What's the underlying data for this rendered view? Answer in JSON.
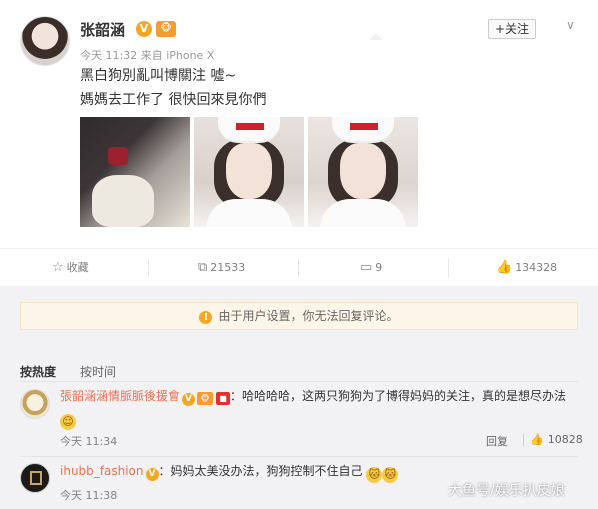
{
  "post": {
    "username": "张韶涵",
    "verified_badge": "V",
    "level_badge": "🐵",
    "meta": "今天 11:32 来自 iPhone X",
    "follow_label": "+关注",
    "line1": "黑白狗別亂叫博關注 噓~",
    "line2": "媽媽去工作了 很快回來見你們"
  },
  "actions": {
    "favorite": {
      "icon": "star-icon",
      "label": "收藏"
    },
    "repost": {
      "icon": "repost-icon",
      "count": "21533"
    },
    "comment": {
      "icon": "comment-icon",
      "count": "9"
    },
    "like": {
      "icon": "thumbs-up-icon",
      "count": "134328"
    }
  },
  "comments_notice": "由于用户设置，你无法回复评论。",
  "sort_tabs": [
    "按热度",
    "按时间"
  ],
  "comments": [
    {
      "name": "張韶涵涵情脈脈後援會",
      "text": "：哈哈哈哈，这两只狗狗为了博得妈妈的关注，真的是想尽办法",
      "time": "今天 11:34",
      "reply": "回复",
      "likes": "10828"
    },
    {
      "name": "ihubb_fashion",
      "text": "：妈妈太美没办法，狗狗控制不住自己",
      "time": "今天 11:38"
    }
  ],
  "watermark": "大鱼号/娱乐扒皮娘",
  "colors": {
    "accent_orange": "#eb7350",
    "badge_orange": "#f5a623",
    "notice_bg": "#fdf5e8",
    "comment_bg": "#f2f2f5"
  }
}
